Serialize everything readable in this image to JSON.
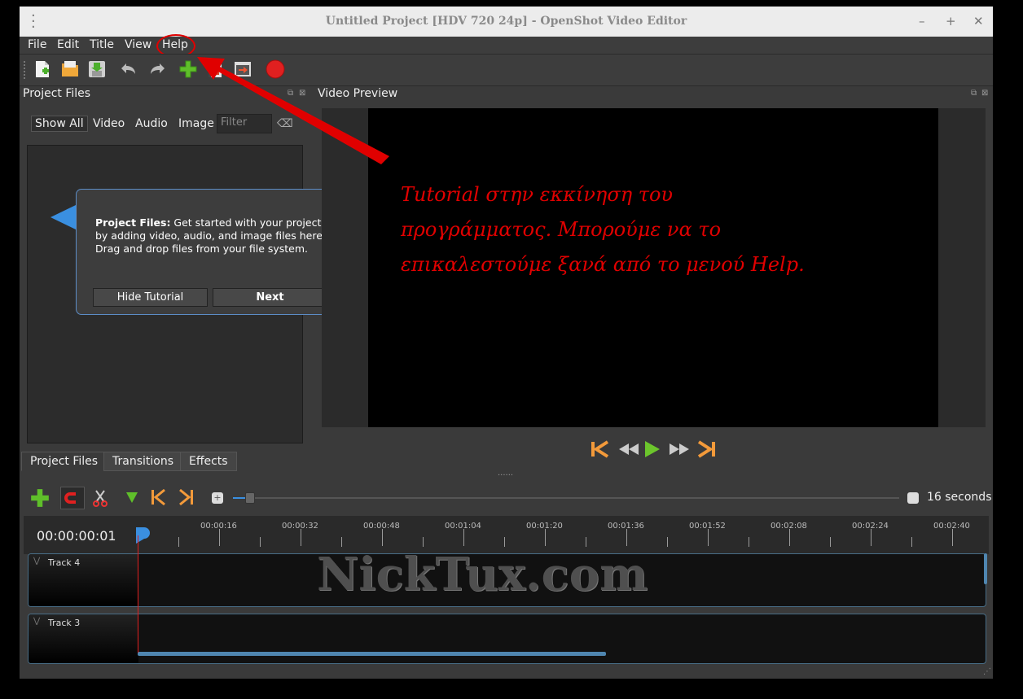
{
  "window": {
    "title": "Untitled Project [HDV 720 24p] - OpenShot Video Editor"
  },
  "menu": [
    "File",
    "Edit",
    "Title",
    "View",
    "Help"
  ],
  "project_files": {
    "title": "Project Files",
    "filters": [
      "Show All",
      "Video",
      "Audio",
      "Image"
    ],
    "filter_placeholder": "Filter"
  },
  "tutorial": {
    "bold": "Project Files:",
    "text": " Get started with your project by adding video, audio, and image files here. Drag and drop files from your file system.",
    "hide_label": "Hide Tutorial",
    "next_label": "Next"
  },
  "video_preview": {
    "title": "Video Preview"
  },
  "annotation": {
    "line1": "Tutorial στην εκκίνηση του",
    "line2": "προγράμματος. Μπορούμε να το",
    "line3": "επικαλεστούμε ξανά από το μενού Help."
  },
  "tabs": [
    "Project Files",
    "Transitions",
    "Effects"
  ],
  "timeline": {
    "zoom_label": "16 seconds",
    "timecode": "00:00:00:01",
    "ticks": [
      "00:00:16",
      "00:00:32",
      "00:00:48",
      "00:01:04",
      "00:01:20",
      "00:01:36",
      "00:01:52",
      "00:02:08",
      "00:02:24",
      "00:02:40"
    ],
    "tracks": [
      "Track 4",
      "Track 3"
    ]
  },
  "watermark": "NickTux.com",
  "colors": {
    "annotation": "#e00000",
    "accent": "#3a8fe0",
    "record": "#e02020"
  }
}
